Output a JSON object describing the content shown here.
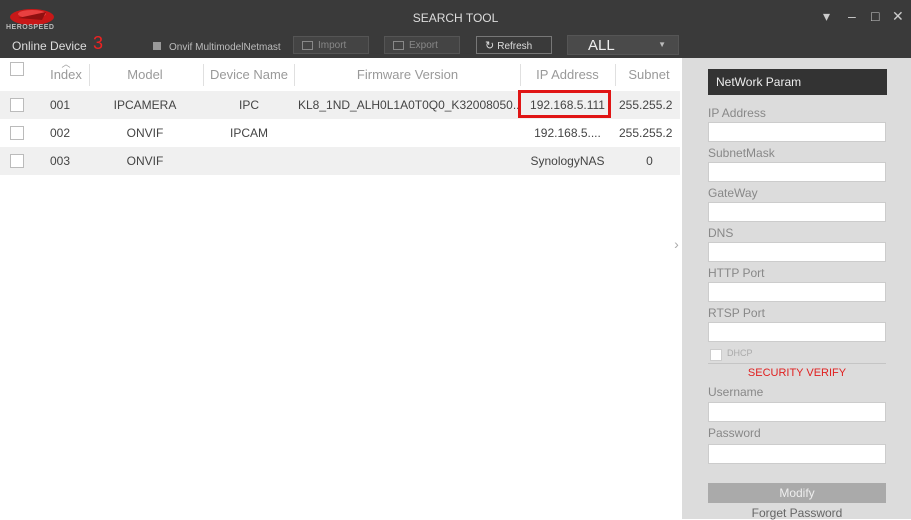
{
  "window": {
    "title": "SEARCH TOOL",
    "logo_text": "HEROSPEED",
    "controls": {
      "dropdown": "▾",
      "minimize": "–",
      "maximize": "□",
      "close": "✕"
    }
  },
  "toolbar": {
    "online_label": "Online Device",
    "online_count": "3",
    "onvif_label": "Onvif MultimodelNetmast",
    "import_label": "Import",
    "export_label": "Export",
    "refresh_label": "Refresh",
    "filter_value": "ALL"
  },
  "table": {
    "headers": [
      "Index",
      "Model",
      "Device Name",
      "Firmware Version",
      "IP Address",
      "Subnet"
    ],
    "rows": [
      {
        "index": "001",
        "model": "IPCAMERA",
        "name": "IPC",
        "firmware": "KL8_1ND_ALH0L1A0T0Q0_K32008050...",
        "ip": "192.168.5.111",
        "subnet": "255.255.2"
      },
      {
        "index": "002",
        "model": "ONVIF",
        "name": "IPCAM",
        "firmware": "",
        "ip": "192.168.5....",
        "subnet": "255.255.2"
      },
      {
        "index": "003",
        "model": "ONVIF",
        "name": "",
        "firmware": "",
        "ip": "SynologyNAS",
        "subnet": "0"
      }
    ]
  },
  "panel": {
    "network_param": "NetWork Param",
    "ip_label": "IP Address",
    "subnet_label": "SubnetMask",
    "gateway_label": "GateWay",
    "dns_label": "DNS",
    "http_label": "HTTP Port",
    "rtsp_label": "RTSP Port",
    "dhcp_label": "DHCP",
    "security_verify": "SECURITY VERIFY",
    "username_label": "Username",
    "password_label": "Password",
    "modify_label": "Modify",
    "forget_label": "Forget Password"
  },
  "colors": {
    "accent_red": "#e01515",
    "titlebar": "#3a3a3a",
    "panel": "#dcdcdc"
  }
}
